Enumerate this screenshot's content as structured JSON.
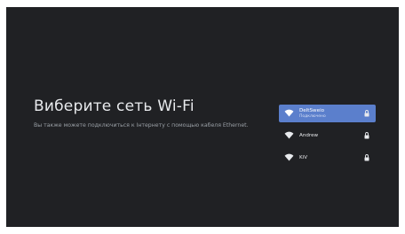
{
  "page": {
    "title": "Виберите сеть Wi-Fi",
    "subtitle": "Вы также можете подключиться к Інтернету с помощью кабеля Ethernet."
  },
  "networks": [
    {
      "name": "DeltSweio",
      "status": "Подключено",
      "selected": true,
      "secured": true
    },
    {
      "name": "Andrew",
      "status": "",
      "selected": false,
      "secured": true
    },
    {
      "name": "KiV",
      "status": "",
      "selected": false,
      "secured": true
    }
  ],
  "colors": {
    "background": "#202124",
    "selected": "#5b7fcc",
    "text": "#e8eaed"
  }
}
